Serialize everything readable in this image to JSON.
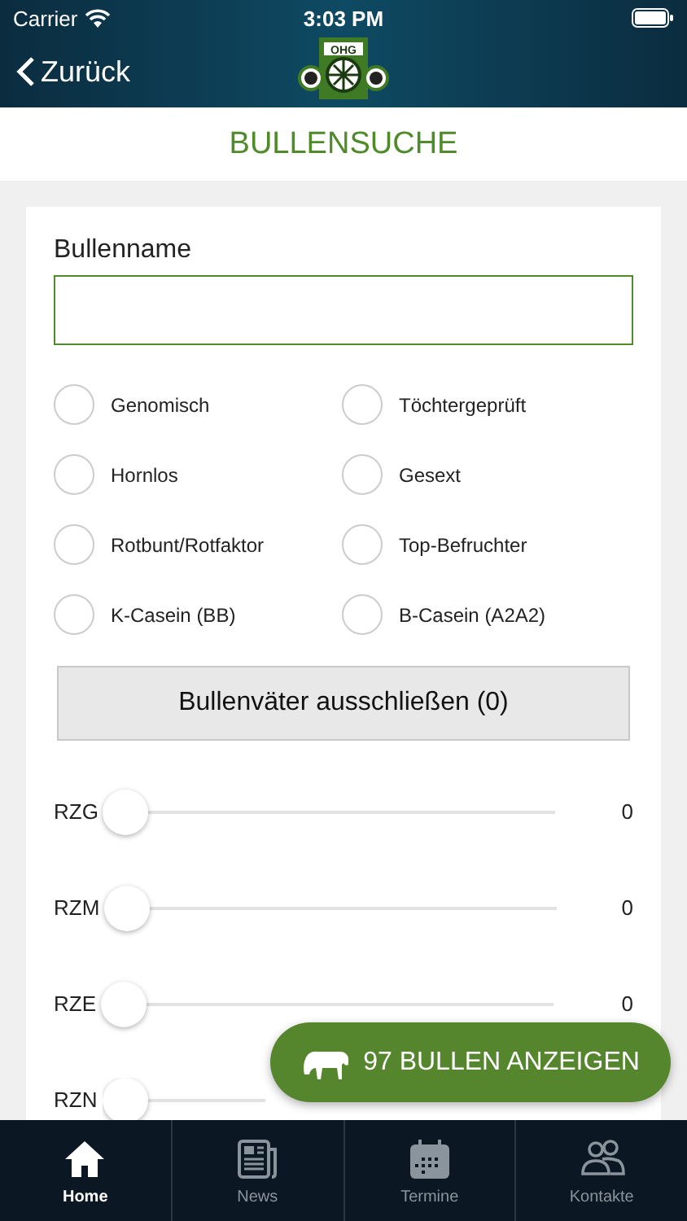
{
  "status_bar": {
    "carrier": "Carrier",
    "time": "3:03 PM"
  },
  "nav": {
    "back": "Zurück",
    "logo_text": "OHG"
  },
  "title": "BULLENSUCHE",
  "name_field": {
    "label": "Bullenname"
  },
  "options": [
    {
      "label": "Genomisch",
      "checked": false
    },
    {
      "label": "Töchtergeprüft",
      "checked": false
    },
    {
      "label": "Hornlos",
      "checked": false
    },
    {
      "label": "Gesext",
      "checked": false
    },
    {
      "label": "Rotbunt/Rotfaktor",
      "checked": false
    },
    {
      "label": "Top-Befruchter",
      "checked": false
    },
    {
      "label": "K-Casein (BB)",
      "checked": false
    },
    {
      "label": "B-Casein (A2A2)",
      "checked": false
    }
  ],
  "exclude_button": "Bullenväter ausschließen (0)",
  "sliders": [
    {
      "label": "RZG",
      "level": 0,
      "reading": "0"
    },
    {
      "label": "RZM",
      "level": 0,
      "reading": "0"
    },
    {
      "label": "RZE",
      "level": 0,
      "reading": "0"
    },
    {
      "label": "RZN",
      "level": 0
    }
  ],
  "show_button": "97 BULLEN ANZEIGEN",
  "tabs": [
    {
      "label": "Home",
      "selected": true
    },
    {
      "label": "News",
      "selected": false
    },
    {
      "label": "Termine",
      "selected": false
    },
    {
      "label": "Kontakte",
      "selected": false
    }
  ]
}
